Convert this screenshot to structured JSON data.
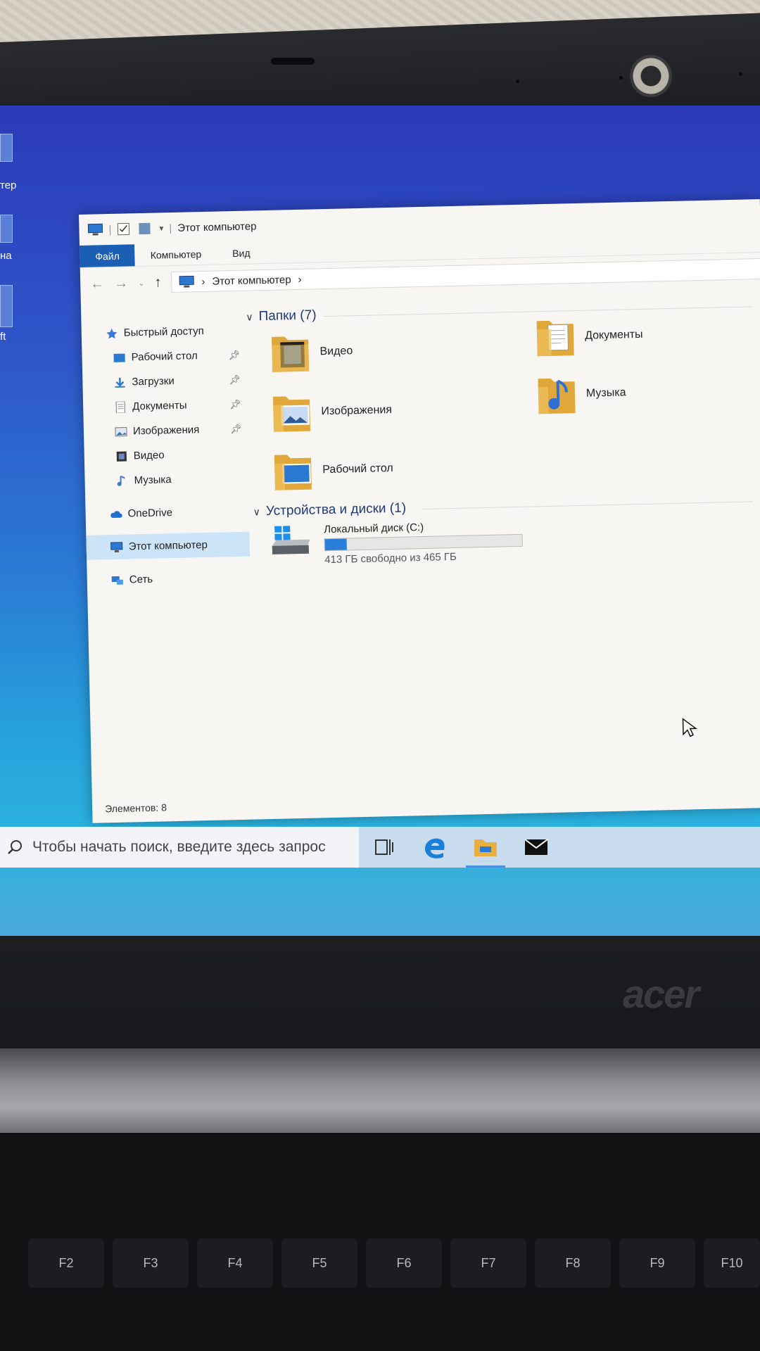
{
  "desktop": {
    "fragment_labels": [
      "тер",
      "на",
      "ft"
    ]
  },
  "window": {
    "title": "Этот компьютер",
    "ribbon_tabs": [
      "Файл",
      "Компьютер",
      "Вид"
    ],
    "address": {
      "location": "Этот компьютер",
      "separator": "›"
    },
    "nav": [
      {
        "label": "Быстрый доступ",
        "icon": "star-icon",
        "root": true,
        "pinned": false
      },
      {
        "label": "Рабочий стол",
        "icon": "desktop-icon",
        "root": false,
        "pinned": true
      },
      {
        "label": "Загрузки",
        "icon": "download-icon",
        "root": false,
        "pinned": true
      },
      {
        "label": "Документы",
        "icon": "document-icon",
        "root": false,
        "pinned": true
      },
      {
        "label": "Изображения",
        "icon": "pictures-icon",
        "root": false,
        "pinned": true
      },
      {
        "label": "Видео",
        "icon": "video-icon",
        "root": false,
        "pinned": false
      },
      {
        "label": "Музыка",
        "icon": "music-icon",
        "root": false,
        "pinned": false
      },
      {
        "label": "OneDrive",
        "icon": "cloud-icon",
        "root": true,
        "pinned": false
      },
      {
        "label": "Этот компьютер",
        "icon": "computer-icon",
        "root": true,
        "pinned": false,
        "selected": true
      },
      {
        "label": "Сеть",
        "icon": "network-icon",
        "root": true,
        "pinned": false
      }
    ],
    "folders_group": {
      "title": "Папки (7)",
      "items": [
        {
          "label": "Видео",
          "icon": "video-folder-icon"
        },
        {
          "label": "Документы",
          "icon": "documents-folder-icon"
        },
        {
          "label": "Изображения",
          "icon": "pictures-folder-icon"
        },
        {
          "label": "Музыка",
          "icon": "music-folder-icon"
        },
        {
          "label": "Рабочий стол",
          "icon": "desktop-folder-icon"
        }
      ]
    },
    "devices_group": {
      "title": "Устройства и диски (1)",
      "drive": {
        "label": "Локальный диск (C:)",
        "free_text": "413 ГБ свободно из 465 ГБ",
        "used_fraction": 0.112
      }
    },
    "status": "Элементов: 8"
  },
  "taskbar": {
    "search_placeholder": "Чтобы начать поиск, введите здесь запрос",
    "buttons": [
      "task-view-icon",
      "edge-icon",
      "file-explorer-icon",
      "mail-icon"
    ]
  },
  "laptop": {
    "brand": "acer",
    "fkeys": [
      "F2",
      "F3",
      "F4",
      "F5",
      "F6",
      "F7",
      "F8",
      "F9",
      "F10"
    ]
  },
  "colors": {
    "accent": "#1a5fb4",
    "selection": "#cce4f7",
    "folder": "#e9b44c",
    "drive_fill": "#2b7ed8"
  }
}
